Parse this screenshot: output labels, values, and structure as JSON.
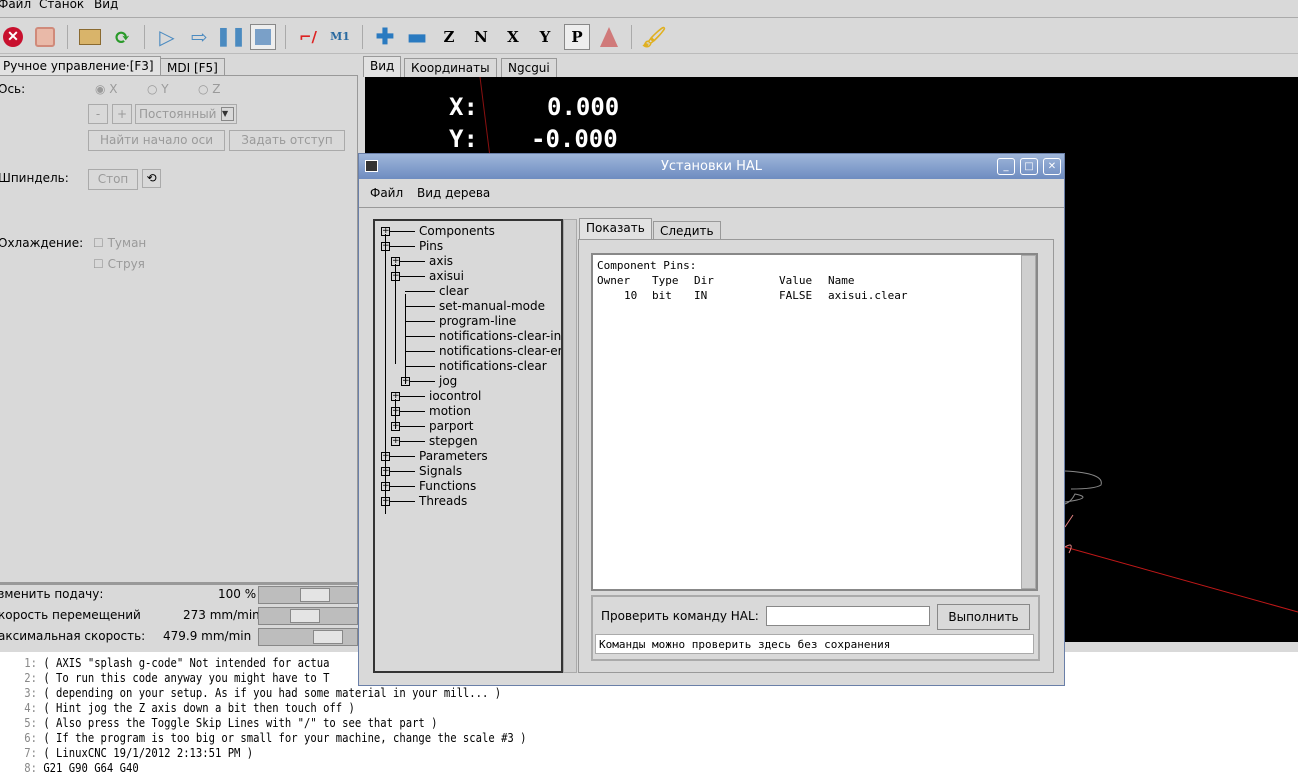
{
  "menu": [
    "Файл",
    "Станок",
    "Вид"
  ],
  "toolbar": [
    {
      "icon": "estop-icon"
    },
    {
      "icon": "power-icon"
    },
    {
      "icon": "open-folder-icon"
    },
    {
      "icon": "reload-icon"
    },
    {
      "icon": "run-icon"
    },
    {
      "icon": "step-icon"
    },
    {
      "icon": "pause-icon"
    },
    {
      "icon": "stop-icon"
    },
    {
      "icon": "skip-lines-icon"
    },
    {
      "icon": "optional-stop-icon"
    },
    {
      "icon": "zoom-in-icon"
    },
    {
      "icon": "zoom-out-icon"
    },
    {
      "icon": "view-z-icon",
      "label": "Z"
    },
    {
      "icon": "view-z-rot-icon",
      "label": "N"
    },
    {
      "icon": "view-x-icon",
      "label": "X"
    },
    {
      "icon": "view-y-icon",
      "label": "Y"
    },
    {
      "icon": "view-p-icon",
      "label": "P"
    },
    {
      "icon": "rotate-icon"
    },
    {
      "icon": "clear-plot-icon"
    }
  ],
  "left": {
    "tabs": [
      "Ручное управление·[F3]",
      "MDI [F5]"
    ],
    "axis_label": "Ось:",
    "axes": [
      "X",
      "Y",
      "Z"
    ],
    "minus": "-",
    "plus": "+",
    "jog_mode": "Постоянный",
    "home_button": "Найти начало оси",
    "touchoff_button": "Задать отступ",
    "spindle_label": "Шпиндель:",
    "spindle_stop": "Стоп",
    "coolant_label": "Охлаждение:",
    "mist": "Туман",
    "flood": "Струя",
    "sliders": [
      {
        "label": "зменить подачу:",
        "value": "100 %",
        "fraction": 0.6
      },
      {
        "label": "корость перемещений",
        "value": "273 mm/min",
        "fraction": 0.45
      },
      {
        "label": "аксимальная скорость:",
        "value": "479.9 mm/min",
        "fraction": 0.8
      }
    ]
  },
  "view": {
    "tabs": [
      "Вид",
      "Координаты",
      "Ngcgui"
    ],
    "dro": [
      {
        "axis": "X:",
        "value": "0.000"
      },
      {
        "axis": "Y:",
        "value": "-0.000"
      }
    ]
  },
  "gcode": [
    {
      "n": "1:",
      "t": "( AXIS \"splash g-code\" Not intended for actua"
    },
    {
      "n": "2:",
      "t": "( To run this code anyway you might have to T"
    },
    {
      "n": "3:",
      "t": "( depending on your setup. As if you had some material in your mill... )"
    },
    {
      "n": "4:",
      "t": "( Hint jog the Z axis down a bit then touch off )"
    },
    {
      "n": "5:",
      "t": "( Also press the Toggle Skip Lines with \"/\" to see that part )"
    },
    {
      "n": "6:",
      "t": "( If the program is too big or small for your machine, change the scale #3 )"
    },
    {
      "n": "7:",
      "t": "( LinuxCNC 19/1/2012 2:13:51 PM )"
    },
    {
      "n": "8:",
      "t": "G21 G90 G64 G40"
    }
  ],
  "hal": {
    "title": "Установки HAL",
    "menu": [
      "Файл",
      "Вид дерева"
    ],
    "tree": [
      {
        "label": "Components",
        "level": 0,
        "expander": "+"
      },
      {
        "label": "Pins",
        "level": 0,
        "expander": "-"
      },
      {
        "label": "axis",
        "level": 1,
        "expander": "+"
      },
      {
        "label": "axisui",
        "level": 1,
        "expander": "-"
      },
      {
        "label": "clear",
        "level": 2
      },
      {
        "label": "set-manual-mode",
        "level": 2
      },
      {
        "label": "program-line",
        "level": 2
      },
      {
        "label": "notifications-clear-in",
        "level": 2
      },
      {
        "label": "notifications-clear-er",
        "level": 2
      },
      {
        "label": "notifications-clear",
        "level": 2
      },
      {
        "label": "jog",
        "level": 2,
        "expander": "+"
      },
      {
        "label": "iocontrol",
        "level": 1,
        "expander": "+"
      },
      {
        "label": "motion",
        "level": 1,
        "expander": "+"
      },
      {
        "label": "parport",
        "level": 1,
        "expander": "+"
      },
      {
        "label": "stepgen",
        "level": 1,
        "expander": "+"
      },
      {
        "label": "Parameters",
        "level": 0,
        "expander": "+"
      },
      {
        "label": "Signals",
        "level": 0,
        "expander": "+"
      },
      {
        "label": "Functions",
        "level": 0,
        "expander": "+"
      },
      {
        "label": "Threads",
        "level": 0,
        "expander": "+"
      }
    ],
    "tabs": [
      "Показать",
      "Следить"
    ],
    "output": {
      "heading": "Component Pins:",
      "columns": [
        "Owner",
        "Type",
        "Dir",
        "Value",
        "Name"
      ],
      "rows": [
        [
          "10",
          "bit",
          "IN",
          "FALSE",
          "axisui.clear"
        ]
      ]
    },
    "command_label": "Проверить команду HAL:",
    "command_value": "",
    "execute": "Выполнить",
    "status": "Команды можно проверить здесь без сохранения"
  }
}
